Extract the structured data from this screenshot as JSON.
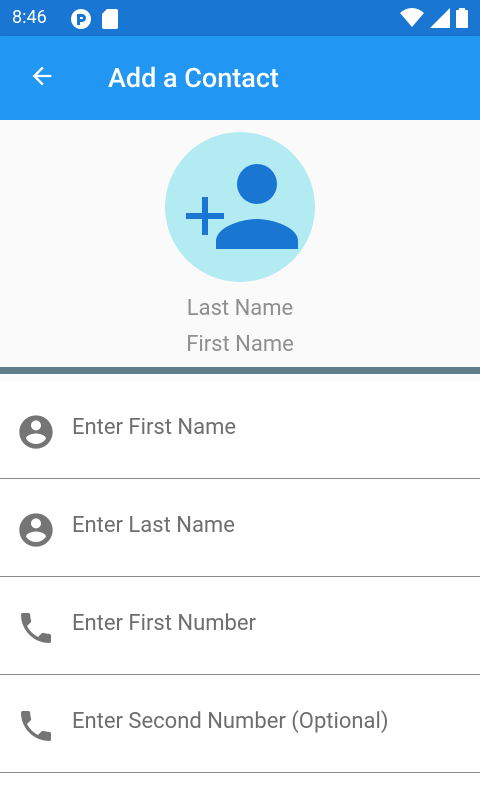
{
  "status_bar": {
    "time": "8:46"
  },
  "app_bar": {
    "title": "Add a Contact"
  },
  "preview": {
    "last_name": "Last Name",
    "first_name": "First Name"
  },
  "form": {
    "fields": [
      {
        "placeholder": "Enter First Name",
        "icon": "account-circle-icon"
      },
      {
        "placeholder": "Enter Last Name",
        "icon": "account-circle-icon"
      },
      {
        "placeholder": "Enter First Number",
        "icon": "phone-icon"
      },
      {
        "placeholder": "Enter Second Number (Optional)",
        "icon": "phone-icon"
      }
    ]
  },
  "colors": {
    "status_bar": "#1976d2",
    "app_bar": "#2196f3",
    "avatar_bg": "#b3ebf2",
    "avatar_icon": "#1976d2",
    "divider": "#607d8b",
    "field_icon": "#757575",
    "placeholder": "#6e6e6e"
  }
}
